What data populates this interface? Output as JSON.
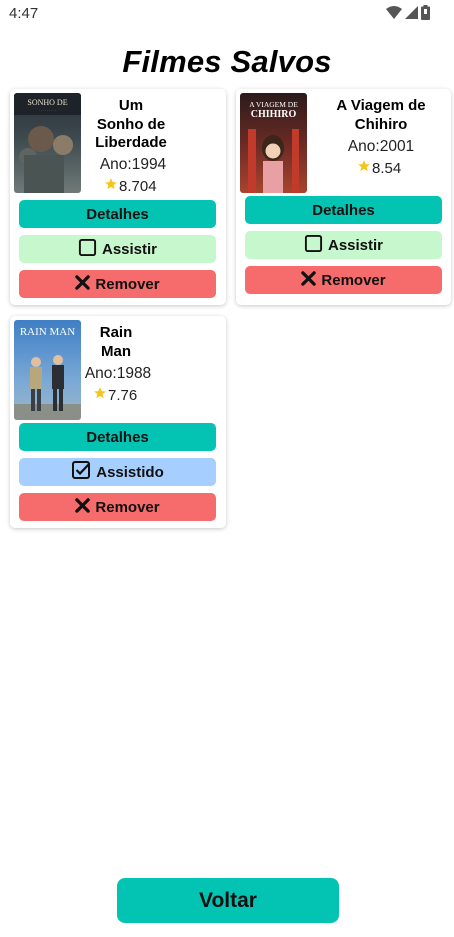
{
  "status_bar": {
    "time": "4:47",
    "icons": [
      "wifi-icon",
      "signal-icon",
      "battery-icon"
    ]
  },
  "page": {
    "title": "Filmes Salvos"
  },
  "movies": [
    {
      "title_lines": [
        "Um",
        "Sonho de",
        "Liberdade"
      ],
      "year": "Ano:1994",
      "rating": "8.704",
      "poster_text": "SONHO DE",
      "details_label": "Detalhes",
      "watch_label": "Assistir",
      "watch_icon": "checkbox-empty-icon",
      "remove_label": "Remover"
    },
    {
      "title_lines": [
        "A Viagem de",
        "Chihiro"
      ],
      "year": "Ano:2001",
      "rating": "8.54",
      "poster_text_lines": [
        "A VIAGEM DE",
        "CHIHIRO"
      ],
      "details_label": "Detalhes",
      "watch_label": "Assistir",
      "watch_icon": "checkbox-empty-icon",
      "remove_label": "Remover"
    },
    {
      "title_lines": [
        "Rain",
        "Man"
      ],
      "year": "Ano:1988",
      "rating": "7.76",
      "poster_text": "RAIN MAN",
      "details_label": "Detalhes",
      "watch_label": "Assistido",
      "watch_icon": "checkbox-checked-icon",
      "remove_label": "Remover"
    }
  ],
  "footer": {
    "back_label": "Voltar"
  },
  "colors": {
    "details": "#03c4b3",
    "watch": "#c7f7cc",
    "watched": "#a6cfff",
    "remove": "#f66b6b",
    "star": "#f5c518"
  }
}
